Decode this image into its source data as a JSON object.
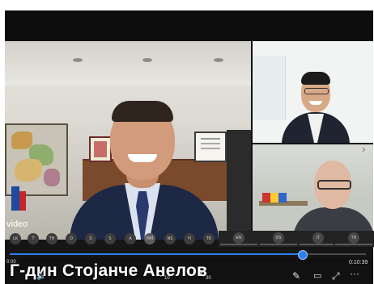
{
  "player": {
    "source_label": "video",
    "elapsed": "0:00",
    "duration": "0:10:39",
    "progress": 0.82,
    "caption": "Г-дин Стојанче Анелов",
    "skip_back_label": "10",
    "skip_forward_label": "30",
    "accent_color": "#2f80ed"
  },
  "participants": [
    {
      "initials": "LK"
    },
    {
      "initials": "T"
    },
    {
      "initials": "TH"
    },
    {
      "initials": "D"
    },
    {
      "initials": "S"
    },
    {
      "initials": "S"
    },
    {
      "initials": "A"
    },
    {
      "initials": "MM"
    },
    {
      "initials": "NS"
    },
    {
      "initials": "H"
    },
    {
      "initials": "TK"
    }
  ],
  "participant_tags": [
    {
      "initials": "EN"
    },
    {
      "initials": "DS"
    },
    {
      "initials": "IT"
    },
    {
      "initials": "TH"
    }
  ],
  "icons": [
    "volume-icon",
    "skip-back-icon",
    "skip-forward-icon",
    "pen-icon",
    "captions-icon",
    "fullscreen-icon",
    "more-icon"
  ]
}
